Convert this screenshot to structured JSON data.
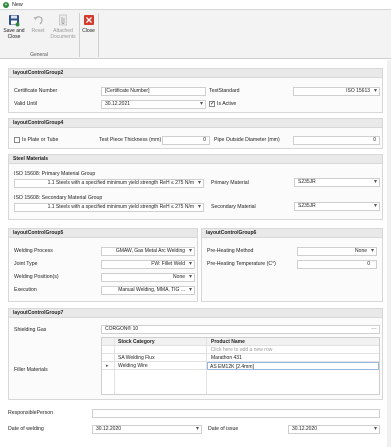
{
  "window": {
    "title": "New"
  },
  "ribbon": {
    "group_label": "General",
    "buttons": {
      "save_close": "Save and Close",
      "reset": "Reset",
      "attached_documents": "Attached Documents",
      "close": "Close"
    }
  },
  "group2": {
    "title": "layoutControlGroup2",
    "certificate_number_label": "Certificate Number",
    "certificate_number_value": "[Certificate Number]",
    "test_standard_label": "TestStandard",
    "test_standard_value": "ISO 15613",
    "valid_until_label": "Valid Until",
    "valid_until_value": "30.12.2021",
    "is_active_label": "Is Active"
  },
  "group4": {
    "title": "layoutControlGroup4",
    "is_plate_label": "Is Plate or Tube",
    "test_piece_thickness_label": "Test Piece Thickness (mm)",
    "test_piece_thickness_value": "0",
    "pipe_od_label": "Pipe Outside Diameter (mm)",
    "pipe_od_value": "0"
  },
  "steel": {
    "title": "Steel Materials",
    "primary_group_label": "ISO 15608: Primary Material Group",
    "primary_group_value": "1.1 Steels with a specified minimum yield strength ReH ≤ 275 N/m",
    "secondary_group_label": "ISO 15608: Secondary Material Group",
    "secondary_group_value": "1.1 Steels with a specified minimum yield strength ReH ≤ 275 N/m",
    "primary_material_label": "Primary Material",
    "primary_material_value": "S235JR",
    "secondary_material_label": "Secondary Material",
    "secondary_material_value": "S235JR"
  },
  "group5": {
    "title": "layoutControlGroup5",
    "welding_process_label": "Welding Process",
    "welding_process_value": "GMAW, Gas Metal Arc Welding",
    "joint_type_label": "Joint Type",
    "joint_type_value": "FW: Fillet Weld",
    "welding_positions_label": "Welding Position(s)",
    "welding_positions_value": "None",
    "execution_label": "Execution",
    "execution_value": "Manual Welding, MMA, TIG ..."
  },
  "group6": {
    "title": "layoutControlGroup6",
    "preheating_method_label": "Pre-Heating Method",
    "preheating_method_value": "None",
    "preheating_temp_label": "Pre-Heating Temperature (C°)",
    "preheating_temp_value": "0"
  },
  "group7": {
    "title": "layoutControlGroup7",
    "shielding_gas_label": "Shielding Gas",
    "shielding_gas_value": "CORGON® 10",
    "filler_materials_label": "Filler Materials",
    "grid": {
      "col_stock": "Stock Category",
      "col_product": "Product Name",
      "new_row_hint": "Click here to add a new row",
      "rows": [
        {
          "stock": "SA Welding Flux",
          "product": "Marathon 431"
        },
        {
          "stock": "Welding Wire",
          "product": "AS EM12K [2.4mm]"
        }
      ]
    }
  },
  "footer": {
    "responsible_label": "ResponsiblePerson",
    "responsible_value": "",
    "date_welding_label": "Date of welding",
    "date_welding_value": "30.12.2020",
    "date_issue_label": "Date of issue",
    "date_issue_value": "30.12.2020"
  }
}
